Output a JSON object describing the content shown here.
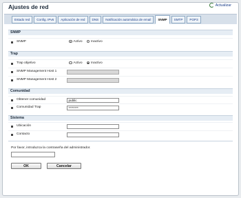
{
  "header": {
    "title": "Ajustes de red",
    "refresh_label": "Actualizar"
  },
  "tabs": [
    {
      "label": "Estado red"
    },
    {
      "label": "Config. IPv6"
    },
    {
      "label": "Aplicación de red"
    },
    {
      "label": "DNS"
    },
    {
      "label": "Notificación automática de email"
    },
    {
      "label": "SNMP",
      "active": true
    },
    {
      "label": "SMTP"
    },
    {
      "label": "POP3"
    }
  ],
  "snmp": {
    "section": "SNMP",
    "row_label": "SNMP",
    "option_active": "Activo",
    "option_inactive": "Inactivo",
    "selected": "Activo"
  },
  "trap": {
    "section": "Trap",
    "target_label": "Trap objetivo",
    "option_active": "Activo",
    "option_inactive": "Inactivo",
    "selected": "Inactivo",
    "host1_label": "SNMP Management Host 1",
    "host1_value": "",
    "host2_label": "SNMP Management Host 2",
    "host2_value": ""
  },
  "community": {
    "section": "Comunidad",
    "get_label": "Obtener comunidad",
    "get_value": "public",
    "trap_label": "Comunidad Trap",
    "trap_value": "********"
  },
  "system": {
    "section": "Sistema",
    "location_label": "Ubicación",
    "location_value": "",
    "contact_label": "Contacto",
    "contact_value": ""
  },
  "footer": {
    "admin_prompt": "Por favor, introduzca la contraseña del administrador.",
    "admin_value": "",
    "ok_label": "OK",
    "cancel_label": "Cancelar"
  }
}
